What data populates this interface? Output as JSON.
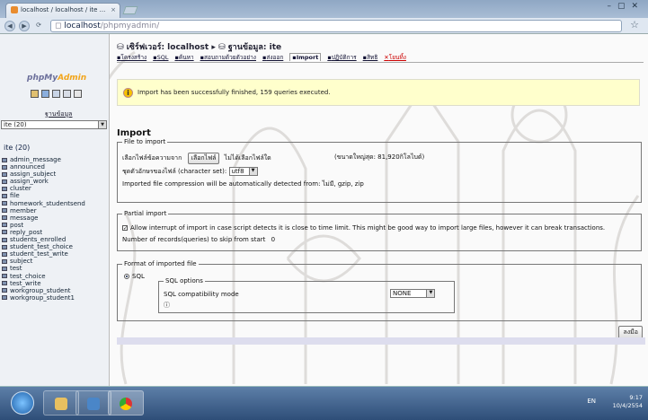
{
  "browser": {
    "tab_title": "localhost / localhost / ite ...",
    "url_host": "localhost",
    "url_path": "/phpmyadmin/"
  },
  "sidebar": {
    "logo_php": "php",
    "logo_my": "My",
    "logo_admin": "Admin",
    "db_label": "ฐานข้อมูล",
    "db_select": "ite (20)",
    "db_name": "ite (20)",
    "tables": [
      "admin_message",
      "announced",
      "assign_subject",
      "assign_work",
      "cluster",
      "file",
      "homework_studentsend",
      "member",
      "message",
      "post",
      "reply_post",
      "students_enrolled",
      "student_test_choice",
      "student_test_write",
      "subject",
      "test",
      "test_choice",
      "test_write",
      "workgroup_student",
      "workgroup_student1"
    ]
  },
  "header": {
    "breadcrumb_server": "เซิร์ฟเวอร์: localhost",
    "breadcrumb_sep": "▸",
    "breadcrumb_db": "ฐานข้อมูล: ite",
    "tabs": [
      {
        "label": "โครงสร้าง"
      },
      {
        "label": "SQL"
      },
      {
        "label": "ค้นหา"
      },
      {
        "label": "สอบถามด้วยตัวอย่าง"
      },
      {
        "label": "ส่งออก"
      },
      {
        "label": "Import"
      },
      {
        "label": "ปฏิบัติการ"
      },
      {
        "label": "สิทธิ"
      },
      {
        "label": "โยนทิ้ง"
      }
    ]
  },
  "notice": {
    "message": "Import has been successfully finished, 159 queries executed."
  },
  "import": {
    "heading": "Import",
    "file_legend": "File to import",
    "file_label": "เลือกไฟล์ข้อความจาก",
    "choose_button": "เลือกไฟล์",
    "no_file_text": "ไม่ได้เลือกไฟล์ใด",
    "max_size": "(ขนาดใหญ่สุด: 81,920กิโลไบต์)",
    "charset_label": "ชุดตัวอักษรของไฟล์ (character set):",
    "charset_value": "utf8",
    "compression_note": "Imported file compression will be automatically detected from: ไม่มี, gzip, zip",
    "partial_legend": "Partial import",
    "partial_allow": "Allow interrupt of import in case script detects it is close to time limit. This might be good way to import large files, however it can break transactions.",
    "skip_label": "Number of records(queries) to skip from start",
    "skip_value": "0",
    "format_legend": "Format of imported file",
    "format_sql": "SQL",
    "sql_options_legend": "SQL options",
    "compat_label": "SQL compatibility mode",
    "compat_value": "NONE",
    "go_button": "ลงมือ"
  },
  "taskbar": {
    "lang": "EN",
    "time": "9:17",
    "date": "10/4/2554"
  }
}
